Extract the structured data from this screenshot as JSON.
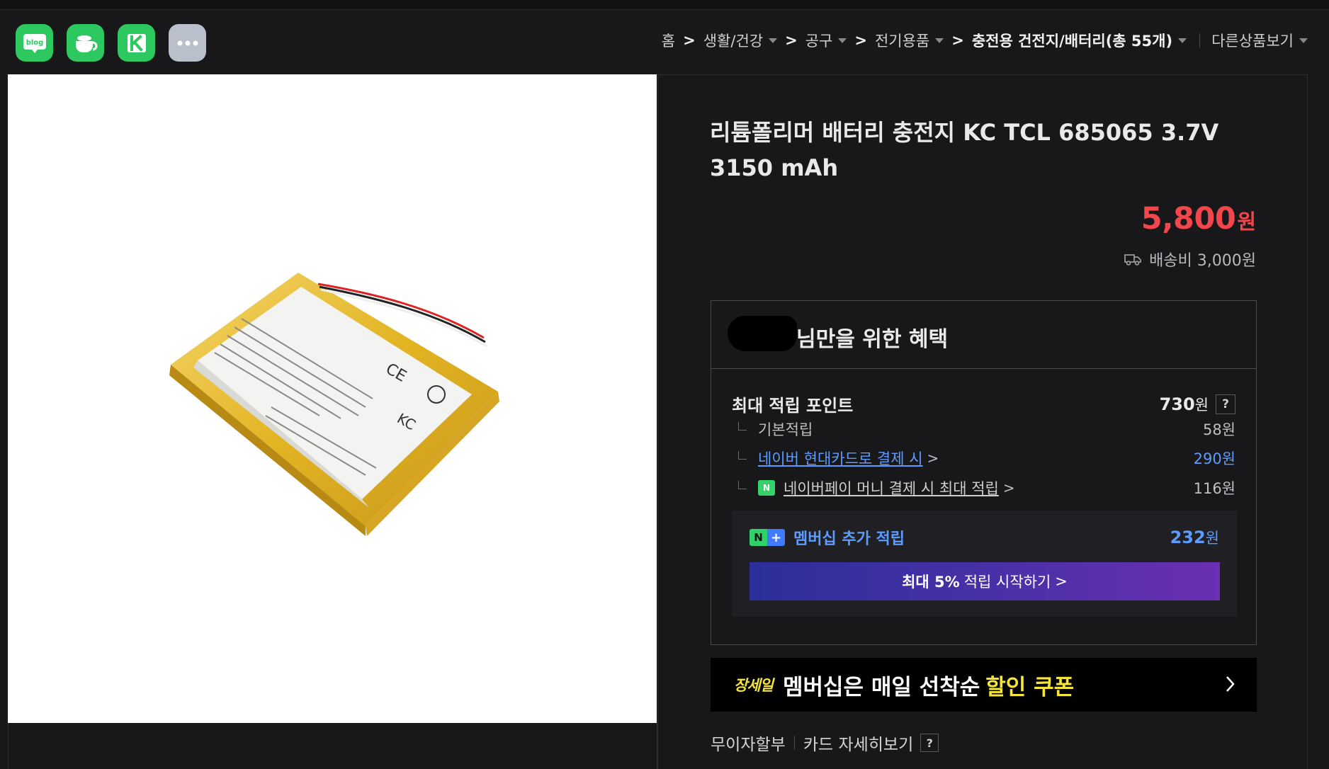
{
  "app_icons": [
    {
      "name": "blog-icon",
      "label": "blog"
    },
    {
      "name": "cafe-icon",
      "label": ""
    },
    {
      "name": "kinfolk-icon",
      "label": ""
    },
    {
      "name": "more-icon",
      "label": ""
    }
  ],
  "breadcrumb": {
    "home": "홈",
    "sep": ">",
    "items": [
      "생활/건강",
      "공구",
      "전기용품"
    ],
    "current": "충전용 건전지/배터리(총 55개)",
    "other": "다른상품보기"
  },
  "product": {
    "title": "리튬폴리머 배터리 충전지 KC TCL 685065 3.7V 3150 mAh",
    "price": "5,800",
    "price_unit": "원",
    "shipping": "배송비 3,000원"
  },
  "benefits": {
    "title": "님만을 위한 혜택",
    "max_points_label": "최대 적립 포인트",
    "max_points_value": "730",
    "won": "원",
    "help": "?",
    "rows": [
      {
        "label": "기본적립",
        "value": "58원"
      },
      {
        "label": "네이버 현대카드로 결제 시",
        "value": "290원"
      },
      {
        "label": "네이버페이 머니 결제 시 최대 적립",
        "value": "116원"
      }
    ],
    "membership_label": "멤버십 추가 적립",
    "membership_value": "232",
    "membership_button_bold": "최대 5%",
    "membership_button_text": "적립 시작하기",
    "chevron": ">"
  },
  "banner": {
    "brand": "장세일",
    "text": "멤버십은 매일 선착순",
    "highlight": "할인 쿠폰"
  },
  "installment": {
    "label1": "무이자할부",
    "label2": "카드 자세히보기",
    "help": "?"
  },
  "colors": {
    "background": "#18181b",
    "price": "#f2464d",
    "link_blue": "#5d9cff",
    "naver_green": "#2ec860",
    "banner_yellow": "#f5e43a"
  }
}
